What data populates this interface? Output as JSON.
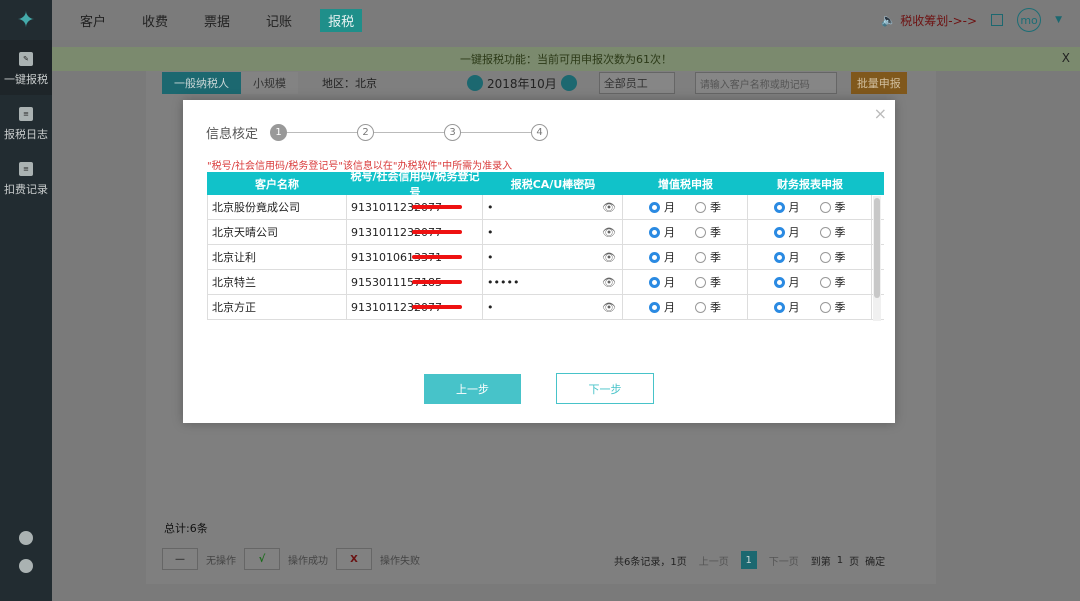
{
  "sidebar": {
    "items": [
      {
        "label": "一键报税"
      },
      {
        "label": "报税日志"
      },
      {
        "label": "扣费记录"
      }
    ]
  },
  "topnav": {
    "items": [
      "客户",
      "收费",
      "票据",
      "记账",
      "报税"
    ],
    "plan": "税收筹划->->",
    "avatar": "mo"
  },
  "notice": {
    "text": "一键报税功能：当前可用申报次数为61次！",
    "close": "X"
  },
  "filter": {
    "tabs": [
      "一般纳税人",
      "小规模"
    ],
    "region": "地区：北京",
    "month": "2018年10月",
    "staff": "全部员工",
    "search_placeholder": "请输入客户名称或助记码",
    "batch": "批量申报"
  },
  "modal": {
    "step_title": "信息核定",
    "steps": [
      "1",
      "2",
      "3",
      "4"
    ],
    "warning": "\"税号/社会信用码/税务登记号\"该信息以在\"办税软件\"中所需为准录入",
    "headers": [
      "客户名称",
      "税号/社会信用码/税务登记号",
      "报税CA/U棒密码",
      "增值税申报",
      "财务报表申报"
    ],
    "rows": [
      {
        "name": "北京股份竟成公司",
        "tax": "9131011232077",
        "pwd": "•"
      },
      {
        "name": "北京天晴公司",
        "tax": "9131011232077",
        "pwd": "•"
      },
      {
        "name": "北京让利",
        "tax": "9131010613371",
        "pwd": "•"
      },
      {
        "name": "北京特兰",
        "tax": "9153011157185",
        "pwd": "•••••"
      },
      {
        "name": "北京方正",
        "tax": "9131011232077",
        "pwd": "•"
      }
    ],
    "month_label": "月",
    "quarter_label": "季",
    "prev": "上一步",
    "next": "下一步"
  },
  "footer": {
    "total": "总计:6条",
    "legend": [
      "无操作",
      "操作成功",
      "操作失败"
    ],
    "pager": {
      "summary": "共6条记录，1页",
      "prev": "上一页",
      "page": "1",
      "next": "下一页",
      "goto": "到第",
      "goto_val": "1",
      "page_unit": "页",
      "confirm": "确定"
    }
  }
}
